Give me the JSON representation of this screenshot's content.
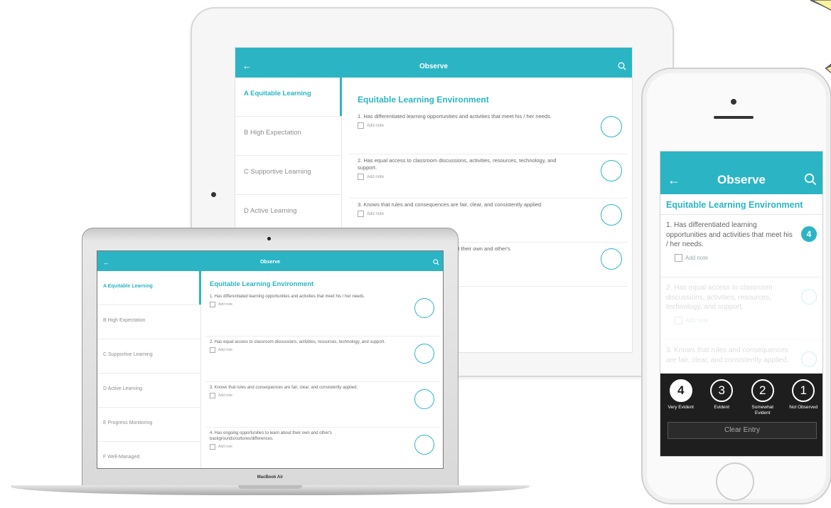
{
  "app": {
    "title": "Observe",
    "accent_color": "#2bb5c4"
  },
  "sidebar": {
    "items": [
      {
        "label": "A  Equitable Learning",
        "active": true
      },
      {
        "label": "B  High Expectation"
      },
      {
        "label": "C  Supportive Learning"
      },
      {
        "label": "D  Active Learning"
      },
      {
        "label": "E  Progress Monitoring"
      },
      {
        "label": "F  Well-Managed"
      }
    ]
  },
  "section": {
    "title": "Equitable Learning Environment",
    "questions": [
      {
        "text": "1.  Has differentiated learning opportunities and activities that meet his / her needs.",
        "note": "Add note"
      },
      {
        "text": "2.  Has equal access to classroom discussions, activities, resources, technology, and support.",
        "note": "Add note"
      },
      {
        "text": "3.  Knows that rules and consequences are fair, clear, and consistently applied.",
        "note": "Add note"
      },
      {
        "text": "4.  Has ongoing opportunities to learn about their own and other's backgrounds/cultures/differences.",
        "note": "Add note"
      }
    ]
  },
  "phone": {
    "q1_rating": "4",
    "rating_options": [
      {
        "num": "4",
        "label": "Very Evident",
        "selected": true
      },
      {
        "num": "3",
        "label": "Evident"
      },
      {
        "num": "2",
        "label": "Somewhat Evident"
      },
      {
        "num": "1",
        "label": "Not Observed"
      }
    ],
    "clear_label": "Clear Entry"
  },
  "laptop": {
    "brand": "MacBook Air"
  },
  "icons": {
    "back": "arrow-left",
    "search": "search-icon",
    "note": "note-icon"
  }
}
